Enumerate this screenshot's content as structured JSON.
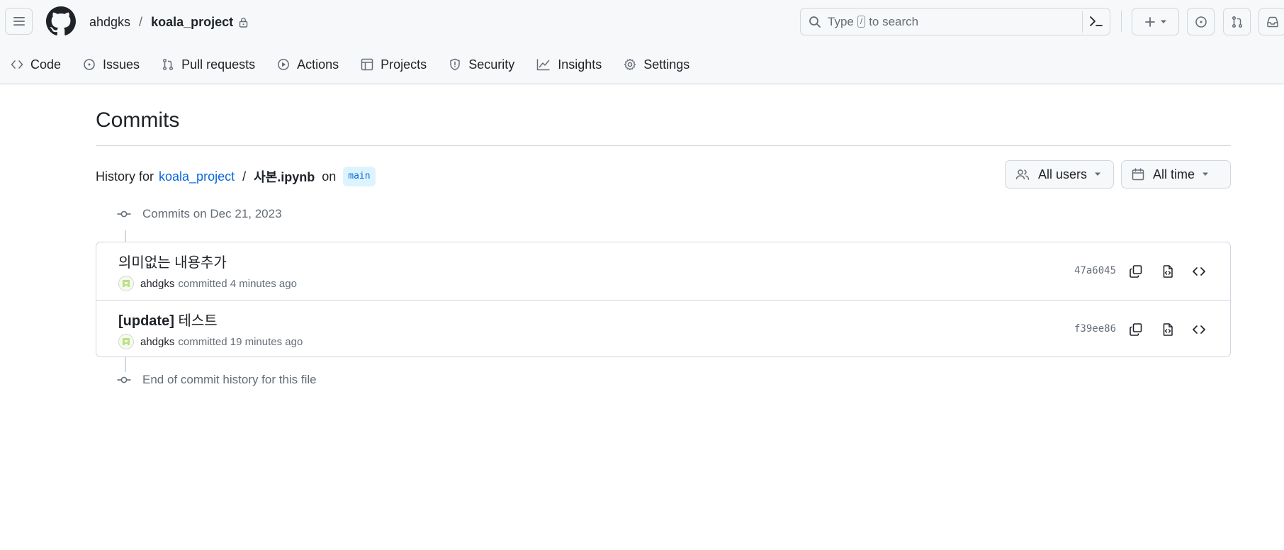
{
  "header": {
    "owner": "ahdgks",
    "separator": "/",
    "repo": "koala_project",
    "search": {
      "before": "Type",
      "key": "/",
      "after": "to search"
    }
  },
  "nav": [
    {
      "name": "nav-code",
      "icon": "code-icon",
      "label": "Code"
    },
    {
      "name": "nav-issues",
      "icon": "issue-icon",
      "label": "Issues"
    },
    {
      "name": "nav-pull-requests",
      "icon": "pull-request-icon",
      "label": "Pull requests"
    },
    {
      "name": "nav-actions",
      "icon": "play-icon",
      "label": "Actions"
    },
    {
      "name": "nav-projects",
      "icon": "table-icon",
      "label": "Projects"
    },
    {
      "name": "nav-security",
      "icon": "shield-icon",
      "label": "Security"
    },
    {
      "name": "nav-insights",
      "icon": "graph-icon",
      "label": "Insights"
    },
    {
      "name": "nav-settings",
      "icon": "gear-icon",
      "label": "Settings"
    }
  ],
  "page": {
    "title": "Commits",
    "history_label": "History for",
    "repo_link": "koala_project",
    "separator": "/",
    "file": "사본.ipynb",
    "on": "on",
    "branch": "main"
  },
  "filters": {
    "users": "All users",
    "time": "All time"
  },
  "timeline": {
    "group_label": "Commits on Dec 21, 2023",
    "end_label": "End of commit history for this file"
  },
  "commits": [
    {
      "message": "의미없는 내용추가",
      "message_prefix": "",
      "author": "ahdgks",
      "action": "committed 4 minutes ago",
      "sha": "47a6045"
    },
    {
      "message": "테스트",
      "message_prefix": "[update]",
      "author": "ahdgks",
      "action": "committed 19 minutes ago",
      "sha": "f39ee86"
    }
  ],
  "colors": {
    "accent": "#0969da",
    "muted": "#656d76",
    "border": "#d0d7de",
    "header_bg": "#f6f8fa"
  }
}
